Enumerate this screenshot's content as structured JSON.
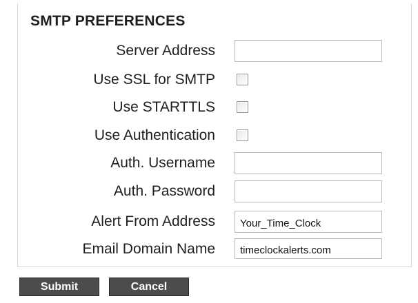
{
  "section": {
    "title": "SMTP PREFERENCES"
  },
  "fields": {
    "server_address": {
      "label": "Server Address",
      "value": ""
    },
    "use_ssl": {
      "label": "Use SSL for SMTP",
      "checked": false
    },
    "use_starttls": {
      "label": "Use STARTTLS",
      "checked": false
    },
    "use_authentication": {
      "label": "Use Authentication",
      "checked": false
    },
    "auth_username": {
      "label": "Auth. Username",
      "value": ""
    },
    "auth_password": {
      "label": "Auth. Password",
      "value": ""
    },
    "alert_from_address": {
      "label": "Alert From Address",
      "value": "Your_Time_Clock"
    },
    "email_domain_name": {
      "label": "Email Domain Name",
      "value": "timeclockalerts.com"
    }
  },
  "actions": {
    "submit_label": "Submit",
    "cancel_label": "Cancel"
  },
  "colors": {
    "button_bg": "#4c4c4c",
    "text": "#1e1e1e",
    "border": "#b8b8b8"
  }
}
